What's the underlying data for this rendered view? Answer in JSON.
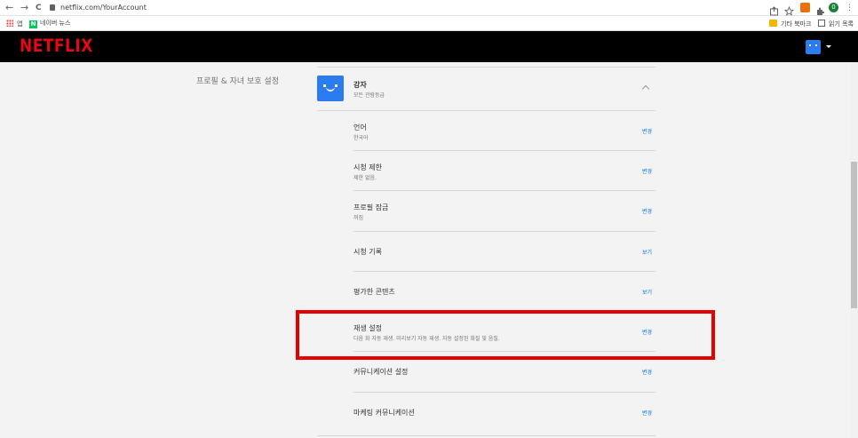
{
  "browser": {
    "back": "←",
    "forward": "→",
    "reload": "C",
    "url": "netflix.com/YourAccount",
    "bookmarks": {
      "apps_label": "앱",
      "naver_badge": "N",
      "naver_news": "네이버 뉴스",
      "other_bookmarks": "기타 북마크",
      "reading_list": "읽기 목록"
    },
    "profile_initial": "0"
  },
  "header": {
    "logo": "NETFLIX"
  },
  "section": {
    "label": "프로필 & 자녀 보호 설정"
  },
  "profile": {
    "name": "강자",
    "rating": "모든 관람등급"
  },
  "settings": [
    {
      "title": "언어",
      "sub": "한국어",
      "action": "변경"
    },
    {
      "title": "시청 제한",
      "sub": "제한 없음.",
      "action": "변경"
    },
    {
      "title": "프로필 잠금",
      "sub": "꺼짐",
      "action": "변경"
    },
    {
      "title": "시청 기록",
      "sub": "",
      "action": "보기"
    },
    {
      "title": "평가한 콘텐츠",
      "sub": "",
      "action": "보기"
    },
    {
      "title": "재생 설정",
      "sub": "다음 화 자동 재생. 미리보기 자동 재생. 자동 설정된 화질 및 음질.",
      "action": "변경"
    },
    {
      "title": "커뮤니케이션 설정",
      "sub": "",
      "action": "변경"
    },
    {
      "title": "마케팅 커뮤니케이션",
      "sub": "",
      "action": "변경"
    }
  ],
  "colors": {
    "netflix_red": "#e50914",
    "link_blue": "#0071eb",
    "highlight_red": "#e50000",
    "avatar_blue": "#2b7cf1"
  }
}
